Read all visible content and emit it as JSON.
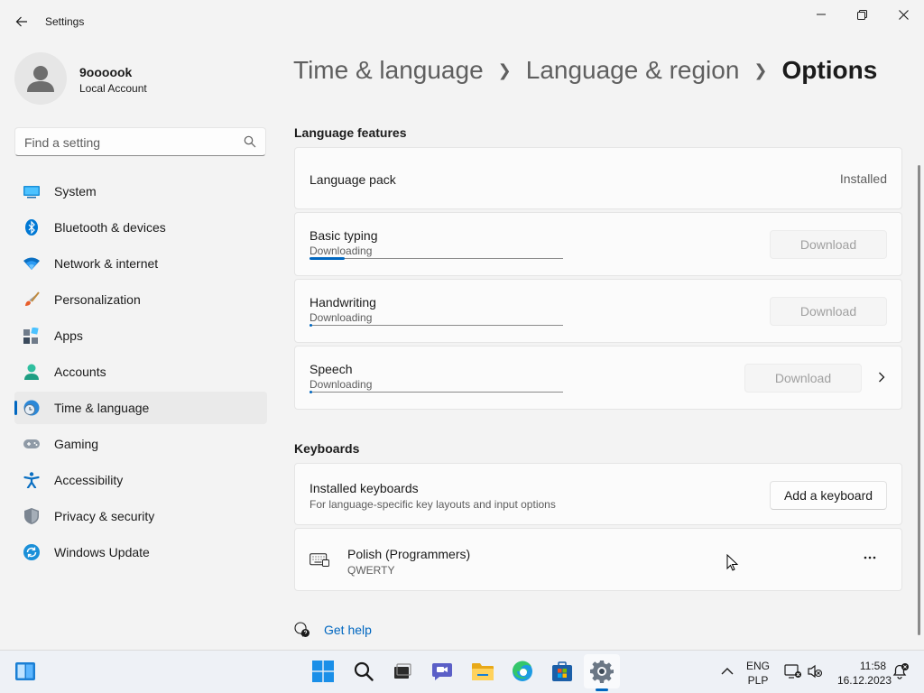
{
  "app": {
    "title": "Settings"
  },
  "user": {
    "name": "9oooook",
    "account_type": "Local Account"
  },
  "search": {
    "placeholder": "Find a setting"
  },
  "sidebar": {
    "items": [
      {
        "label": "System",
        "icon": "system-icon"
      },
      {
        "label": "Bluetooth & devices",
        "icon": "bluetooth-icon"
      },
      {
        "label": "Network & internet",
        "icon": "wifi-icon"
      },
      {
        "label": "Personalization",
        "icon": "brush-icon"
      },
      {
        "label": "Apps",
        "icon": "apps-icon"
      },
      {
        "label": "Accounts",
        "icon": "accounts-icon"
      },
      {
        "label": "Time & language",
        "icon": "time-language-icon",
        "selected": true
      },
      {
        "label": "Gaming",
        "icon": "gamepad-icon"
      },
      {
        "label": "Accessibility",
        "icon": "accessibility-icon"
      },
      {
        "label": "Privacy & security",
        "icon": "shield-icon"
      },
      {
        "label": "Windows Update",
        "icon": "update-icon"
      }
    ]
  },
  "breadcrumb": {
    "items": [
      "Time & language",
      "Language & region"
    ],
    "current": "Options"
  },
  "language_features": {
    "title": "Language features",
    "language_pack": {
      "label": "Language pack",
      "status": "Installed"
    },
    "basic_typing": {
      "label": "Basic typing",
      "status": "Downloading",
      "button": "Download",
      "progress": 0.14
    },
    "handwriting": {
      "label": "Handwriting",
      "status": "Downloading",
      "button": "Download",
      "progress": 0.01
    },
    "speech": {
      "label": "Speech",
      "status": "Downloading",
      "button": "Download",
      "progress": 0.01
    }
  },
  "keyboards": {
    "title": "Keyboards",
    "installed": {
      "label": "Installed keyboards",
      "description": "For language-specific key layouts and input options",
      "button": "Add a keyboard"
    },
    "polish": {
      "name": "Polish (Programmers)",
      "layout": "QWERTY"
    }
  },
  "help": {
    "label": "Get help"
  },
  "taskbar": {
    "language": "ENG",
    "layout": "PLP",
    "time": "11:58",
    "date": "16.12.2023"
  },
  "colors": {
    "accent": "#0067c0",
    "background": "#f3f3f3",
    "card": "#fbfbfb"
  }
}
